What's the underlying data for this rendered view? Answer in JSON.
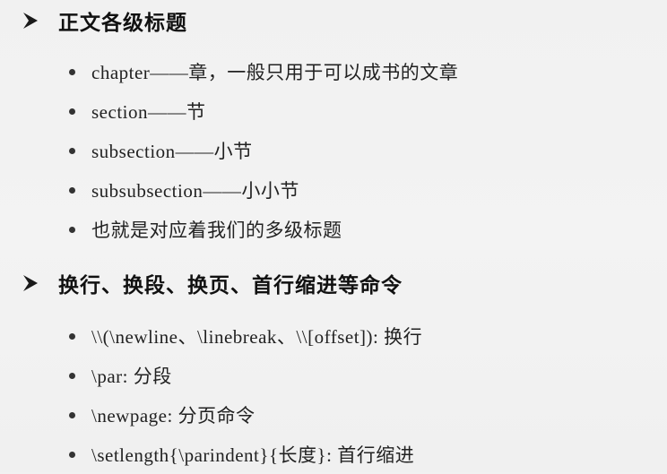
{
  "sections": [
    {
      "title": "正文各级标题",
      "items": [
        "chapter——章，一般只用于可以成书的文章",
        "section——节",
        "subsection——小节",
        "subsubsection——小小节",
        "也就是对应着我们的多级标题"
      ]
    },
    {
      "title": "换行、换段、换页、首行缩进等命令",
      "items": [
        "\\\\(\\newline、\\linebreak、\\\\[offset]): 换行",
        "\\par: 分段",
        "\\newpage: 分页命令",
        "\\setlength{\\parindent}{长度}: 首行缩进"
      ]
    }
  ],
  "icons": {
    "heading_marker": "arrowhead-bullet-icon",
    "list_marker": "round-bullet-icon"
  }
}
